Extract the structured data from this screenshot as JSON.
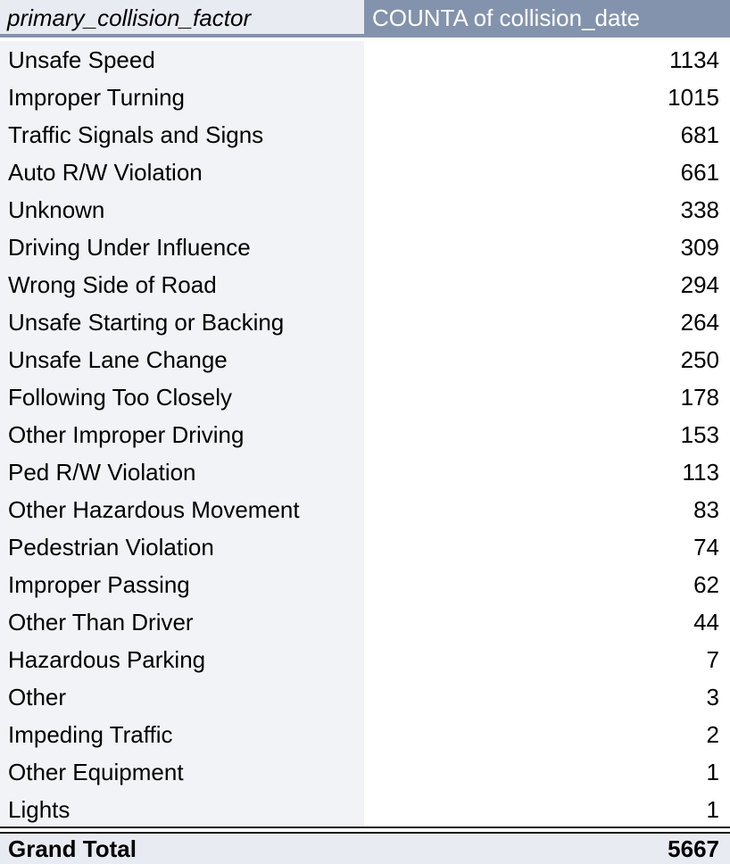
{
  "header": {
    "col1": "primary_collision_factor",
    "col2": "COUNTA of collision_date"
  },
  "rows": [
    {
      "label": "Unsafe Speed",
      "value": "1134"
    },
    {
      "label": "Improper Turning",
      "value": "1015"
    },
    {
      "label": "Traffic Signals and Signs",
      "value": "681"
    },
    {
      "label": "Auto R/W Violation",
      "value": "661"
    },
    {
      "label": "Unknown",
      "value": "338"
    },
    {
      "label": "Driving Under Influence",
      "value": "309"
    },
    {
      "label": "Wrong Side of Road",
      "value": "294"
    },
    {
      "label": "Unsafe Starting or Backing",
      "value": "264"
    },
    {
      "label": "Unsafe Lane Change",
      "value": "250"
    },
    {
      "label": "Following Too Closely",
      "value": "178"
    },
    {
      "label": "Other Improper Driving",
      "value": "153"
    },
    {
      "label": "Ped R/W Violation",
      "value": "113"
    },
    {
      "label": "Other Hazardous Movement",
      "value": "83"
    },
    {
      "label": "Pedestrian Violation",
      "value": "74"
    },
    {
      "label": "Improper Passing",
      "value": "62"
    },
    {
      "label": "Other Than Driver",
      "value": "44"
    },
    {
      "label": "Hazardous Parking",
      "value": "7"
    },
    {
      "label": "Other",
      "value": "3"
    },
    {
      "label": "Impeding Traffic",
      "value": "2"
    },
    {
      "label": "Other Equipment",
      "value": "1"
    },
    {
      "label": "Lights",
      "value": "1"
    }
  ],
  "total": {
    "label": "Grand Total",
    "value": "5667"
  },
  "colors": {
    "header_bg": "#8393ad",
    "header_label_bg": "#e8ebf1",
    "row_label_bg": "#f1f3f6"
  }
}
